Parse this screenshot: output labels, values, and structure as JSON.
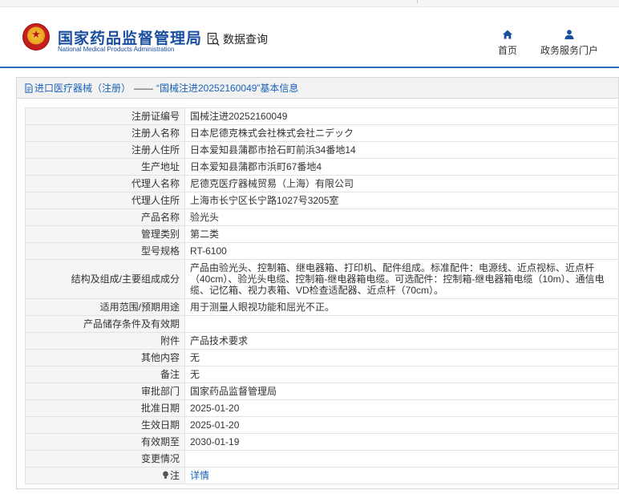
{
  "header": {
    "brand_cn": "国家药品监督管理局",
    "brand_en": "National Medical Products Administration",
    "data_query": "数据查询",
    "nav": {
      "home": "首页",
      "portal": "政务服务门户"
    }
  },
  "breadcrumb": {
    "category": "进口医疗器械（注册）",
    "separator": "——",
    "title": "“国械注进20252160049”基本信息"
  },
  "rows": [
    {
      "key": "注册证编号",
      "value": "国械注进20252160049"
    },
    {
      "key": "注册人名称",
      "value": "日本尼德克株式会社株式会社ニデック"
    },
    {
      "key": "注册人住所",
      "value": "日本爱知县蒲郡市拾石町前浜34番地14"
    },
    {
      "key": "生产地址",
      "value": "日本爱知县蒲郡市浜町67番地4"
    },
    {
      "key": "代理人名称",
      "value": "尼德克医疗器械贸易（上海）有限公司"
    },
    {
      "key": "代理人住所",
      "value": "上海市长宁区长宁路1027号3205室"
    },
    {
      "key": "产品名称",
      "value": "验光头"
    },
    {
      "key": "管理类别",
      "value": "第二类"
    },
    {
      "key": "型号规格",
      "value": "RT-6100"
    },
    {
      "key": "结构及组成/主要组成成分",
      "value": "产品由验光头、控制箱、继电器箱、打印机、配件组成。标准配件：电源线、近点视标、近点杆（40cm）、验光头电缆、控制箱-继电器箱电缆。可选配件：控制箱-继电器箱电缆（10m）、通信电缆、记忆箱、视力表箱、VD检查适配器、近点杆（70cm）。"
    },
    {
      "key": "适用范围/预期用途",
      "value": "用于测量人眼视功能和屈光不正。"
    },
    {
      "key": "产品储存条件及有效期",
      "value": ""
    },
    {
      "key": "附件",
      "value": "产品技术要求"
    },
    {
      "key": "其他内容",
      "value": "无"
    },
    {
      "key": "备注",
      "value": "无"
    },
    {
      "key": "审批部门",
      "value": "国家药品监督管理局"
    },
    {
      "key": "批准日期",
      "value": "2025-01-20"
    },
    {
      "key": "生效日期",
      "value": "2025-01-20"
    },
    {
      "key": "有效期至",
      "value": "2030-01-19"
    },
    {
      "key": "变更情况",
      "value": ""
    }
  ],
  "note_row": {
    "key": "注",
    "link": "详情"
  },
  "colors": {
    "brand_blue": "#1a4fa0",
    "link_blue": "#1a62b8",
    "key_bg": "#f5f5f5"
  },
  "icons": [
    "national-emblem-icon",
    "search-document-icon",
    "home-icon",
    "user-icon",
    "document-icon",
    "bulb-icon"
  ]
}
